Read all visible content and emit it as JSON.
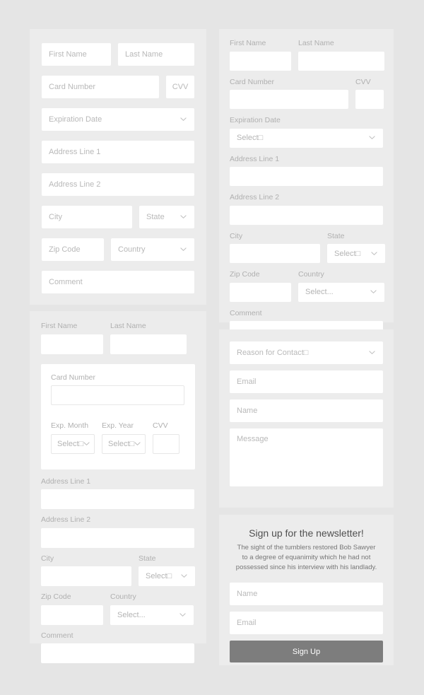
{
  "colors": {
    "page_background": "#e5e5e5",
    "panel_background": "#ececec",
    "field_background": "#ffffff",
    "placeholder_text": "#b9b9b9",
    "label_text": "#b0b0b0",
    "button_background": "#7d7d7d",
    "button_text": "#ffffff",
    "card_border": "#e7e7e7",
    "heading_text": "#4f4f4f",
    "body_text": "#767676"
  },
  "icons": {
    "chevron_down": "chevron-down-icon"
  },
  "payment_inline_form": {
    "first_name": {
      "placeholder": "First Name"
    },
    "last_name": {
      "placeholder": "Last Name"
    },
    "card_number": {
      "placeholder": "Card Number"
    },
    "cvv": {
      "placeholder": "CVV"
    },
    "expiration_date": {
      "placeholder": "Expiration Date"
    },
    "address_line_1": {
      "placeholder": "Address Line 1"
    },
    "address_line_2": {
      "placeholder": "Address Line 2"
    },
    "city": {
      "placeholder": "City"
    },
    "state": {
      "placeholder": "State"
    },
    "zip_code": {
      "placeholder": "Zip Code"
    },
    "country": {
      "placeholder": "Country"
    },
    "comment": {
      "placeholder": "Comment"
    }
  },
  "payment_stacked_form": {
    "first_name": {
      "label": "First Name",
      "value": ""
    },
    "last_name": {
      "label": "Last Name",
      "value": ""
    },
    "card_number": {
      "label": "Card Number",
      "value": ""
    },
    "exp_month": {
      "label": "Exp. Month",
      "value": "Select□"
    },
    "exp_year": {
      "label": "Exp. Year",
      "value": "Select□"
    },
    "cvv": {
      "label": "CVV",
      "value": ""
    },
    "address_line_1": {
      "label": "Address Line 1",
      "value": ""
    },
    "address_line_2": {
      "label": "Address Line 2",
      "value": ""
    },
    "city": {
      "label": "City",
      "value": ""
    },
    "state": {
      "label": "State",
      "value": "Select□"
    },
    "zip_code": {
      "label": "Zip Code",
      "value": ""
    },
    "country": {
      "label": "Country",
      "value": "Select..."
    },
    "comment": {
      "label": "Comment",
      "value": ""
    }
  },
  "payment_labeled_form": {
    "first_name": {
      "label": "First Name",
      "value": ""
    },
    "last_name": {
      "label": "Last Name",
      "value": ""
    },
    "card_number": {
      "label": "Card Number",
      "value": ""
    },
    "cvv": {
      "label": "CVV",
      "value": ""
    },
    "expiration_date": {
      "label": "Expiration Date",
      "value": "Select□"
    },
    "address_line_1": {
      "label": "Address Line 1",
      "value": ""
    },
    "address_line_2": {
      "label": "Address Line 2",
      "value": ""
    },
    "city": {
      "label": "City",
      "value": ""
    },
    "state": {
      "label": "State",
      "value": "Select□"
    },
    "zip_code": {
      "label": "Zip Code",
      "value": ""
    },
    "country": {
      "label": "Country",
      "value": "Select..."
    },
    "comment": {
      "label": "Comment",
      "value": ""
    }
  },
  "contact_form": {
    "reason": {
      "placeholder": "Reason for Contact□"
    },
    "email": {
      "placeholder": "Email"
    },
    "name": {
      "placeholder": "Name"
    },
    "message": {
      "placeholder": "Message"
    }
  },
  "newsletter": {
    "title": "Sign up for the newsletter!",
    "body": "The sight of the tumblers restored Bob Sawyer to a degree of equanimity which he had not possessed since his interview with his landlady.",
    "name": {
      "placeholder": "Name"
    },
    "email": {
      "placeholder": "Email"
    },
    "submit_label": "Sign Up"
  }
}
